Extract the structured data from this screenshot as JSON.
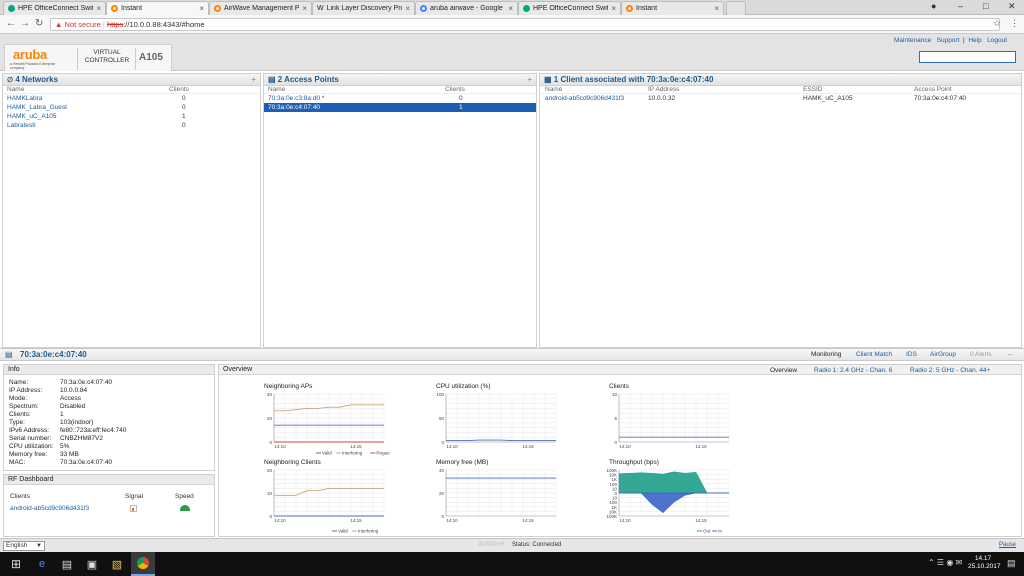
{
  "browser": {
    "tabs": [
      {
        "title": "HPE OfficeConnect Swit",
        "color": "#01a982"
      },
      {
        "title": "Instant",
        "color": "#ff8300"
      },
      {
        "title": "AirWave Management P",
        "color": "#ff8300"
      },
      {
        "title": "Link Layer Discovery Pro",
        "color": "#888888"
      },
      {
        "title": "aruba airwave - Google",
        "color": "#4285f4"
      },
      {
        "title": "HPE OfficeConnect Swit",
        "color": "#01a982"
      },
      {
        "title": "Instant",
        "color": "#ff8300"
      }
    ],
    "not_secure": "Not secure",
    "url_scheme": "https",
    "url_rest": "://10.0.0.88:4343/#home"
  },
  "header": {
    "brand": "aruba",
    "brand_sub": "a Hewlett Packard Enterprise company",
    "virtual_controller": "VIRTUAL CONTROLLER",
    "controller_name": "A105",
    "links": [
      "Maintenance",
      "Support",
      "Help",
      "Logout"
    ],
    "search_value": ""
  },
  "networks": {
    "title": "4 Networks",
    "col_name": "Name",
    "col_clients": "Clients",
    "rows": [
      {
        "name": "HAMKLabra",
        "clients": "0"
      },
      {
        "name": "HAMK_Labra_Guest",
        "clients": "0"
      },
      {
        "name": "HAMK_uC_A105",
        "clients": "1"
      },
      {
        "name": "Labratesti",
        "clients": "0"
      }
    ]
  },
  "access_points": {
    "title": "2 Access Points",
    "col_name": "Name",
    "col_clients": "Clients",
    "rows": [
      {
        "name": "70:3a:0e:c3:8a:d0 *",
        "clients": "0"
      },
      {
        "name": "70:3a:0e:c4:07:40",
        "clients": "1"
      }
    ]
  },
  "clients": {
    "title": "1 Client associated with 70:3a:0e:c4:07:40",
    "columns": [
      "Name",
      "IP Address",
      "ESSID",
      "Access Point"
    ],
    "rows": [
      {
        "name": "android-ab5cd9c906d431f3",
        "ip": "10.0.0.32",
        "essid": "HAMK_uC_A105",
        "ap": "70:3a:0e:c4:07:40"
      }
    ]
  },
  "detail": {
    "title": "70:3a:0e:c4:07:40",
    "tabs": [
      "Monitoring",
      "Client Match",
      "IDS",
      "AirGroup",
      "0 Alerts"
    ],
    "info_title": "Info",
    "info": [
      {
        "k": "Name:",
        "v": "70:3a:0e:c4:07:40"
      },
      {
        "k": "IP Address:",
        "v": "10.0.0.84"
      },
      {
        "k": "Mode:",
        "v": "Access"
      },
      {
        "k": "Spectrum:",
        "v": "Disabled"
      },
      {
        "k": "Clients:",
        "v": "1"
      },
      {
        "k": "Type:",
        "v": "103(indoor)"
      },
      {
        "k": "IPv6 Address:",
        "v": "fe80::723a:eff:fec4:740"
      },
      {
        "k": "Serial number:",
        "v": "CNBZHM87V2"
      },
      {
        "k": "CPU utilization:",
        "v": "5%"
      },
      {
        "k": "Memory free:",
        "v": "33 MB"
      },
      {
        "k": "MAC:",
        "v": "70:3a:0e:c4:07:40"
      }
    ],
    "rf_title": "RF Dashboard",
    "rf_cols": [
      "Clients",
      "Signal",
      "Speed"
    ],
    "rf_client": "android-ab5cd9c906d431f3",
    "overview_title": "Overview",
    "overview_tabs": [
      "Overview",
      "Radio 1: 2.4 GHz - Chan. 6",
      "Radio 2: 5 GHz - Chan. 44+"
    ]
  },
  "chart_data": [
    {
      "type": "line",
      "title": "Neighboring APs",
      "ylim": [
        0,
        40
      ],
      "yticks": [
        "40",
        "20",
        "0"
      ],
      "xticks": [
        "14:10",
        "14:15"
      ],
      "series": [
        {
          "name": "Valid",
          "color": "#4f6fb3",
          "x": [
            0,
            1,
            2,
            3,
            4,
            5,
            6,
            7,
            8,
            9,
            10
          ],
          "values": [
            14,
            14,
            14,
            14,
            14,
            14,
            14,
            14,
            14,
            14,
            14
          ]
        },
        {
          "name": "Interfering",
          "color": "#c9a27a",
          "x": [
            0,
            1,
            2,
            3,
            4,
            5,
            6,
            7,
            8,
            9,
            10
          ],
          "values": [
            26,
            26,
            27,
            28,
            28,
            29,
            29,
            31,
            31,
            31,
            31
          ]
        },
        {
          "name": "Rogue",
          "color": "#d84040",
          "x": [
            0,
            10
          ],
          "values": [
            0,
            0
          ]
        }
      ]
    },
    {
      "type": "line",
      "title": "CPU utilization  (%)",
      "ylim": [
        0,
        100
      ],
      "yticks": [
        "100",
        "50",
        "0"
      ],
      "xticks": [
        "14:10",
        "14:15"
      ],
      "series": [
        {
          "color": "#4f6fb3",
          "x": [
            0,
            1,
            2,
            3,
            4,
            5,
            6,
            7,
            8,
            9,
            10
          ],
          "values": [
            3,
            3,
            3,
            4,
            4,
            4,
            3,
            3,
            3,
            3,
            3
          ]
        }
      ]
    },
    {
      "type": "line",
      "title": "Clients",
      "ylim": [
        0,
        10
      ],
      "yticks": [
        "10",
        "5",
        "0"
      ],
      "xticks": [
        "14:10",
        "14:15"
      ],
      "series": [
        {
          "color": "#4f6fb3",
          "x": [
            0,
            10
          ],
          "values": [
            1,
            1
          ]
        }
      ]
    },
    {
      "type": "line",
      "title": "Neighboring Clients",
      "ylim": [
        0,
        20
      ],
      "yticks": [
        "20",
        "10",
        "0"
      ],
      "xticks": [
        "14:10",
        "14:15"
      ],
      "series": [
        {
          "name": "Valid",
          "color": "#4f6fb3",
          "x": [
            0,
            10
          ],
          "values": [
            0,
            0
          ]
        },
        {
          "name": "Interfering",
          "color": "#c9a27a",
          "x": [
            0,
            1,
            2,
            3,
            4,
            5,
            6,
            7,
            8,
            9,
            10
          ],
          "values": [
            9,
            9,
            9,
            11,
            11,
            12,
            12,
            12,
            12,
            12,
            12
          ]
        }
      ]
    },
    {
      "type": "line",
      "title": "Memory free  (MB)",
      "ylim": [
        0,
        40
      ],
      "yticks": [
        "40",
        "20",
        "0"
      ],
      "xticks": [
        "14:10",
        "14:15"
      ],
      "series": [
        {
          "color": "#4f6fb3",
          "x": [
            0,
            10
          ],
          "values": [
            33,
            33
          ]
        }
      ]
    },
    {
      "type": "area",
      "title": "Throughput  (bps)",
      "yticks": [
        "100K",
        "10K",
        "1K",
        "100",
        "10",
        "0",
        "10",
        "100",
        "1K",
        "10K",
        "100K"
      ],
      "xticks": [
        "14:10",
        "14:15"
      ],
      "series": [
        {
          "name": "Out",
          "color": "#1f9e89",
          "x": [
            0,
            1,
            2,
            3,
            4,
            5,
            6,
            7,
            8,
            9,
            10
          ],
          "values": [
            4.2,
            4.3,
            4.4,
            4.3,
            4.1,
            4.6,
            4.3,
            4.5,
            0,
            0,
            0
          ]
        },
        {
          "name": "In",
          "color": "#3c64c8",
          "x": [
            0,
            1,
            2,
            3,
            4,
            5,
            6,
            7,
            8,
            9,
            10
          ],
          "values": [
            0,
            0,
            0,
            -2.5,
            -4.3,
            -2,
            -0.5,
            0,
            0,
            0,
            0
          ]
        }
      ]
    }
  ],
  "statusbar": {
    "language": "English",
    "airwave": "AirWave",
    "status": "Status: Connected",
    "pause": "Pause"
  },
  "taskbar": {
    "time": "14.17",
    "date": "25.10.2017"
  }
}
